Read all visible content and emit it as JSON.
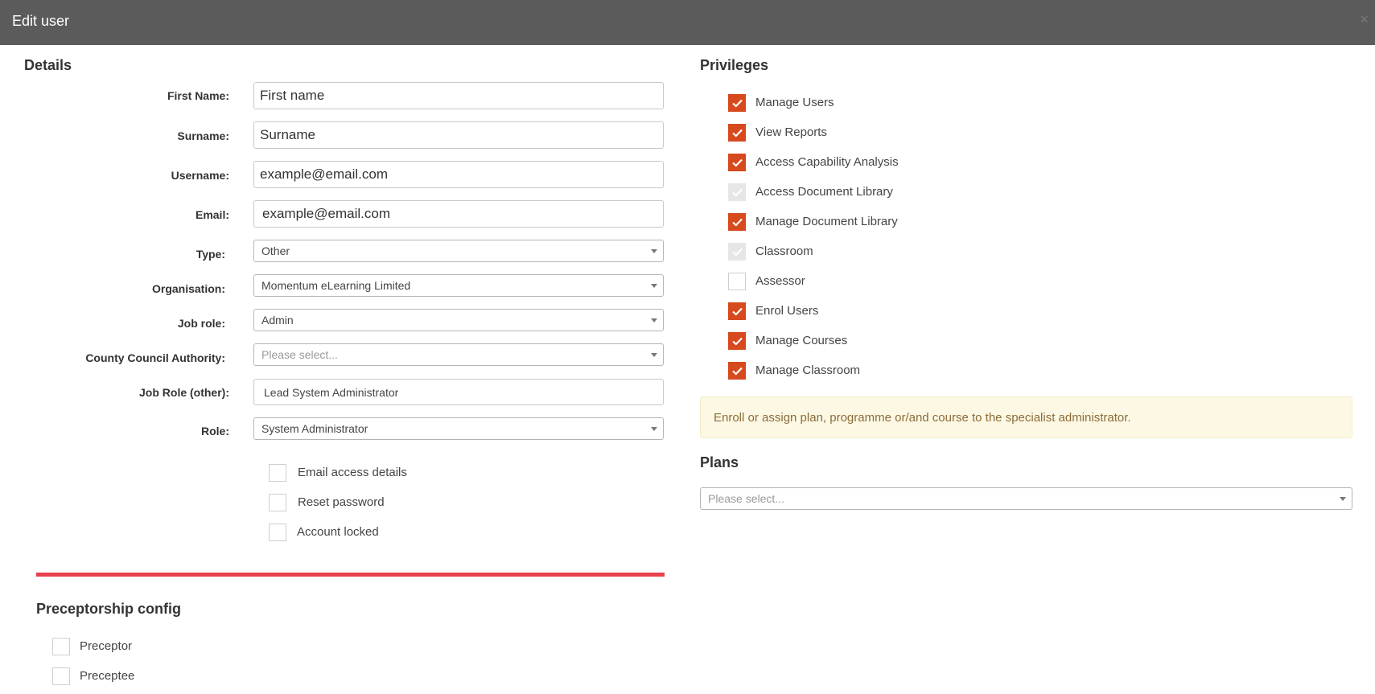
{
  "header": {
    "title": "Edit user",
    "close_glyph": "×"
  },
  "details": {
    "title": "Details",
    "fields": {
      "first_name": {
        "label": "First Name:",
        "value": "First name"
      },
      "surname": {
        "label": "Surname:",
        "value": "Surname"
      },
      "username": {
        "label": "Username:",
        "value": "example@email.com"
      },
      "email": {
        "label": "Email:",
        "value": "example@email.com"
      },
      "type": {
        "label": "Type:",
        "value": "Other"
      },
      "organisation": {
        "label": "Organisation:",
        "value": "Momentum eLearning Limited"
      },
      "job_role": {
        "label": "Job role:",
        "value": "Admin"
      },
      "county_council": {
        "label": "County Council Authority:",
        "placeholder": "Please select..."
      },
      "job_role_other": {
        "label": "Job Role (other):",
        "value": "Lead System Administrator"
      },
      "role": {
        "label": "Role:",
        "value": "System Administrator"
      }
    },
    "options": [
      {
        "label": "Email access details",
        "checked": false
      },
      {
        "label": "Reset password",
        "checked": false
      },
      {
        "label": "Account locked",
        "checked": false
      }
    ]
  },
  "preceptorship": {
    "title": "Preceptorship config",
    "options": [
      {
        "label": "Preceptor",
        "checked": false
      },
      {
        "label": "Preceptee",
        "checked": false
      }
    ]
  },
  "privileges": {
    "title": "Privileges",
    "items": [
      {
        "label": "Manage Users",
        "state": "checked"
      },
      {
        "label": "View Reports",
        "state": "checked"
      },
      {
        "label": "Access Capability Analysis",
        "state": "checked"
      },
      {
        "label": "Access Document Library",
        "state": "disabled-checked"
      },
      {
        "label": "Manage Document Library",
        "state": "checked"
      },
      {
        "label": "Classroom",
        "state": "disabled-checked"
      },
      {
        "label": "Assessor",
        "state": "unchecked"
      },
      {
        "label": "Enrol Users",
        "state": "checked"
      },
      {
        "label": "Manage Courses",
        "state": "checked"
      },
      {
        "label": "Manage Classroom",
        "state": "checked"
      }
    ]
  },
  "notice": {
    "text": "Enroll or assign plan, programme or/and course to the specialist administrator."
  },
  "plans": {
    "title": "Plans",
    "placeholder": "Please select..."
  },
  "colors": {
    "header_bg": "#5b5b5b",
    "checkbox_checked": "#d64a1e",
    "checkbox_disabled": "#e6e6e6",
    "alert_bg": "#fcf8e3",
    "alert_text": "#8a6d3b",
    "divider": "#e8414b"
  }
}
